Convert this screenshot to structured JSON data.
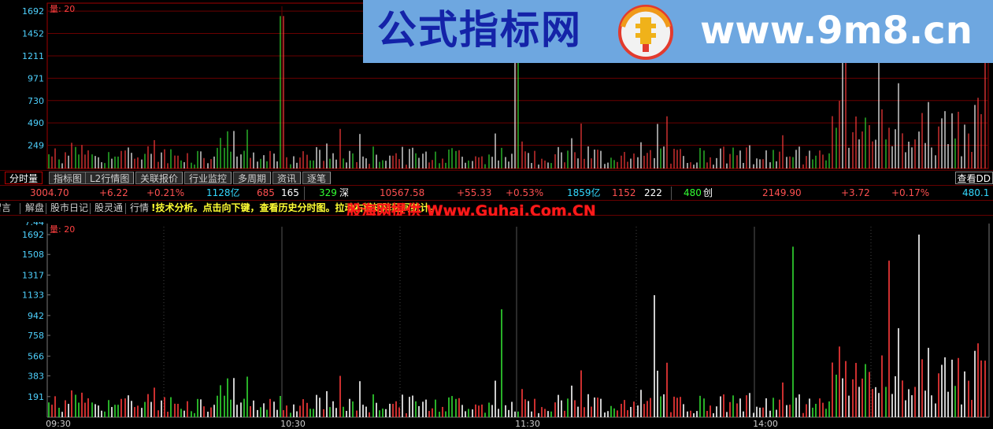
{
  "top_chart": {
    "title": "量: 20",
    "y_ticks": [
      "1692",
      "1452",
      "1211",
      "971",
      "730",
      "490",
      "249"
    ],
    "y_max": 1692
  },
  "bottom_chart": {
    "title": "量: 20",
    "corner_value": "7.44",
    "y_ticks": [
      "1692",
      "1508",
      "1317",
      "1133",
      "942",
      "758",
      "566",
      "383",
      "191"
    ],
    "y_max": 1692,
    "time_labels": [
      "09:30",
      "10:30",
      "11:30",
      "14:00"
    ]
  },
  "colors": {
    "up": "#ff3b3b",
    "down": "#33dd33",
    "flat": "#ffffff",
    "axis": "#4fd2ff",
    "frame": "#a00000",
    "banner": "#6ea7e0"
  },
  "tabs": [
    {
      "label": "分时量",
      "active": true
    },
    {
      "label": "指标图"
    },
    {
      "label": "L2行情图"
    },
    {
      "label": "关联报价"
    },
    {
      "label": "行业监控"
    },
    {
      "label": "多周期"
    },
    {
      "label": "资讯"
    },
    {
      "label": "逐笔"
    }
  ],
  "tab_right": "查看DD",
  "index_bar": {
    "sh_price": "3004.70",
    "sh_change": "+6.22",
    "sh_pct": "+0.21%",
    "sh_amount": "1128亿",
    "sh_up": "685",
    "sh_flat": "165",
    "sh_down": "329",
    "sz_name": "深",
    "sz_price": "10567.58",
    "sz_change": "+55.33",
    "sz_pct": "+0.53%",
    "sz_amount": "1859亿",
    "sz_up": "1152",
    "sz_flat": "222",
    "sz_down": "480",
    "cy_name": "创",
    "cy_price": "2149.90",
    "cy_change": "+3.72",
    "cy_pct": "+0.17%",
    "cy_amount": "480.1"
  },
  "menu": [
    "留言",
    "解盘",
    "股市日记",
    "股灵通",
    "行情"
  ],
  "marquee": "!技术分析。点击向下键，查看历史分时图。拉动右键矩阵区间统计。",
  "overlay_site": "股海网提供 Www.Guhai.Com.CN",
  "banner": {
    "title": "公式指标网",
    "url": "www.9m8.cn",
    "logo_text": "www.9m8.cn"
  },
  "chart_data": {
    "type": "bar",
    "title": "量: 20",
    "ylim": [
      0,
      1692
    ],
    "x": [
      "09:30",
      "10:30",
      "11:30",
      "14:00"
    ],
    "note_colors": "red=up, green=down, white=flat"
  }
}
